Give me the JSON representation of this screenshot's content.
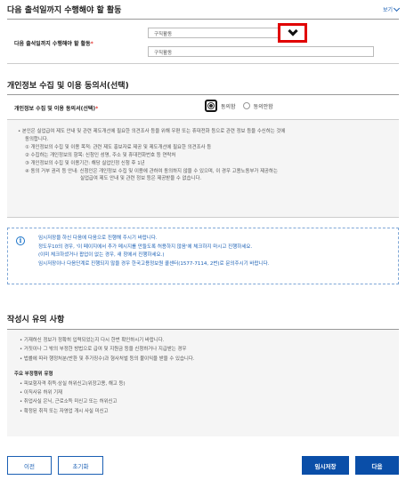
{
  "section1": {
    "title": "다음 출석일까지 수행해야 할 활동",
    "fold_label": "보기",
    "activity_label": "다음 출석일까지 수행해야 할 활동",
    "required_mark": "*",
    "select_value": "구직활동",
    "text_value": "구직활동"
  },
  "section2": {
    "title": "개인정보 수집 및 이용 동의서(선택)",
    "consent_label": "개인정보 수집 및 이용 동의서(선택)",
    "required_mark": "*",
    "agree_label": "동의함",
    "disagree_label": "동의안함",
    "details": [
      "• 본인은 실업급여 제도 안내 및 관련 제도개선에 필요한 의견조사 등을 위해 우편 또는 휴대전화 등으로 관련 정보 등을 수신하는 것에",
      "동의합니다.",
      "① 개인정보의 수집 및 이용 목적: 관련 제도 홍보자료 제공 및 제도개선에 필요한 의견조사 등",
      "② 수집하는 개인정보의 항목: 신청인 성명, 주소 및 휴대전화번호 등 연락처",
      "③ 개인정보의 수집 및 이용기간: 해당 실업인정 신청 후 1년",
      "④ 동의 거부 권리 등 안내: 신청인은 개인정보 수집 및 이용에 관하여 동의하지 않을 수 있으며, 이 경우 고용노동부가 제공하는",
      "실업급여 제도 안내 및 관련 정보 등은 제공받을 수 없습니다."
    ]
  },
  "info": {
    "icon_glyph": "i",
    "lines": [
      "임시저장을 하신 다음에 다음으로 진행해 주시기 바랍니다.",
      "정도우10의 경우, '이 페이지에서 추가 메시지를 만들도록 허용하지 않음'에 체크하지 마시고 진행하세요.",
      "(이미 체크하셨거나 팝업이 없는 경우, 새 창에서 진행하세요.)",
      "임시저장이나 다음단계로 진행되지 않을 경우 한국고용정보원 콜센터(1577-7114, 2번)로 문의주시기 바랍니다."
    ]
  },
  "section3": {
    "title": "작성시 유의 사항",
    "notes": [
      "• 기재하신 정보가 정확히 입력되었는지 다시 한번 확인하시기 바랍니다.",
      "• 거짓이나 그 밖의 부정한 방법으로 급여 및 지원금 등을 신청하거나 지급받는 경우",
      "• 법률에 따라 행정처분(반환 및 추가징수)과 형사처벌 등의 불이익을 받을 수 있습니다."
    ],
    "fraud_title": "주요 부정행위 유형",
    "fraud_items": [
      "• 피보험자격 취득·상실 허위신고(위장고용, 해고 등)",
      "• 이직사유 허위 기재",
      "• 취업사실 은닉, 근로소득 미신고 또는 허위신고",
      "• 확정된 취직 또는 자영업 개시 사실 미신고"
    ]
  },
  "buttons": {
    "prev": "이전",
    "reset": "초기화",
    "temp_save": "임시저장",
    "next": "다음"
  }
}
